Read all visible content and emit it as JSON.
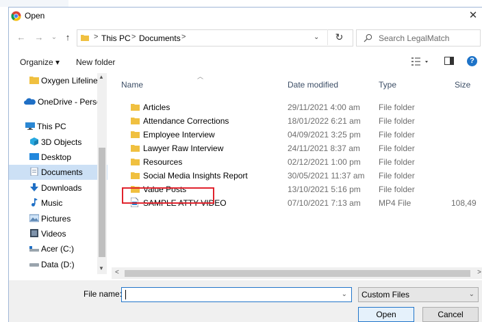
{
  "window": {
    "title": "Open",
    "close_glyph": "✕"
  },
  "nav_buttons": {
    "back": "←",
    "forward": "→",
    "recent": "⌄",
    "up": "↑"
  },
  "address": {
    "parts": [
      "This PC",
      "Documents"
    ],
    "separator": ">",
    "dropdown": "⌄",
    "refresh": "↻"
  },
  "search": {
    "placeholder": "Search LegalMatch"
  },
  "toolbar": {
    "organize_label": "Organize ▾",
    "new_folder_label": "New folder",
    "help_label": "?"
  },
  "sidebar": {
    "items": [
      {
        "label": "Oxygen Lifeline",
        "icon": "folder-icon"
      },
      {
        "label": "OneDrive - Person",
        "icon": "onedrive-icon"
      },
      {
        "label": "This PC",
        "icon": "this-pc-icon"
      },
      {
        "label": "3D Objects",
        "icon": "3d-objects-icon"
      },
      {
        "label": "Desktop",
        "icon": "desktop-icon"
      },
      {
        "label": "Documents",
        "icon": "documents-icon",
        "selected": true
      },
      {
        "label": "Downloads",
        "icon": "downloads-icon"
      },
      {
        "label": "Music",
        "icon": "music-icon"
      },
      {
        "label": "Pictures",
        "icon": "pictures-icon"
      },
      {
        "label": "Videos",
        "icon": "videos-icon"
      },
      {
        "label": "Acer (C:)",
        "icon": "drive-c-icon"
      },
      {
        "label": "Data (D:)",
        "icon": "drive-d-icon"
      }
    ]
  },
  "columns": {
    "name": "Name",
    "date": "Date modified",
    "type": "Type",
    "size": "Size"
  },
  "files": [
    {
      "name": "Articles",
      "date": "29/11/2021 4:00 am",
      "type": "File folder",
      "size": "",
      "icon": "folder-icon"
    },
    {
      "name": "Attendance Corrections",
      "date": "18/01/2022 6:21 am",
      "type": "File folder",
      "size": "",
      "icon": "folder-icon"
    },
    {
      "name": "Employee Interview",
      "date": "04/09/2021 3:25 pm",
      "type": "File folder",
      "size": "",
      "icon": "folder-icon"
    },
    {
      "name": "Lawyer Raw Interview",
      "date": "24/11/2021 8:37 am",
      "type": "File folder",
      "size": "",
      "icon": "folder-icon"
    },
    {
      "name": "Resources",
      "date": "02/12/2021 1:00 pm",
      "type": "File folder",
      "size": "",
      "icon": "folder-icon"
    },
    {
      "name": "Social Media Insights Report",
      "date": "30/05/2021 11:37 am",
      "type": "File folder",
      "size": "",
      "icon": "folder-icon"
    },
    {
      "name": "Value Posts",
      "date": "13/10/2021 5:16 pm",
      "type": "File folder",
      "size": "",
      "icon": "folder-icon"
    },
    {
      "name": "SAMPLE ATTY VIDEO",
      "date": "07/10/2021 7:13 am",
      "type": "MP4 File",
      "size": "108,49",
      "icon": "video-file-icon",
      "highlighted": true
    }
  ],
  "footer": {
    "file_name_label": "File name:",
    "file_name_value": "",
    "file_type_value": "Custom Files",
    "open_label": "Open",
    "cancel_label": "Cancel"
  },
  "colors": {
    "accent": "#1e73c8",
    "highlight_border": "#e0212b",
    "folder": "#f0c040",
    "selected_bg": "#cce0f5"
  }
}
